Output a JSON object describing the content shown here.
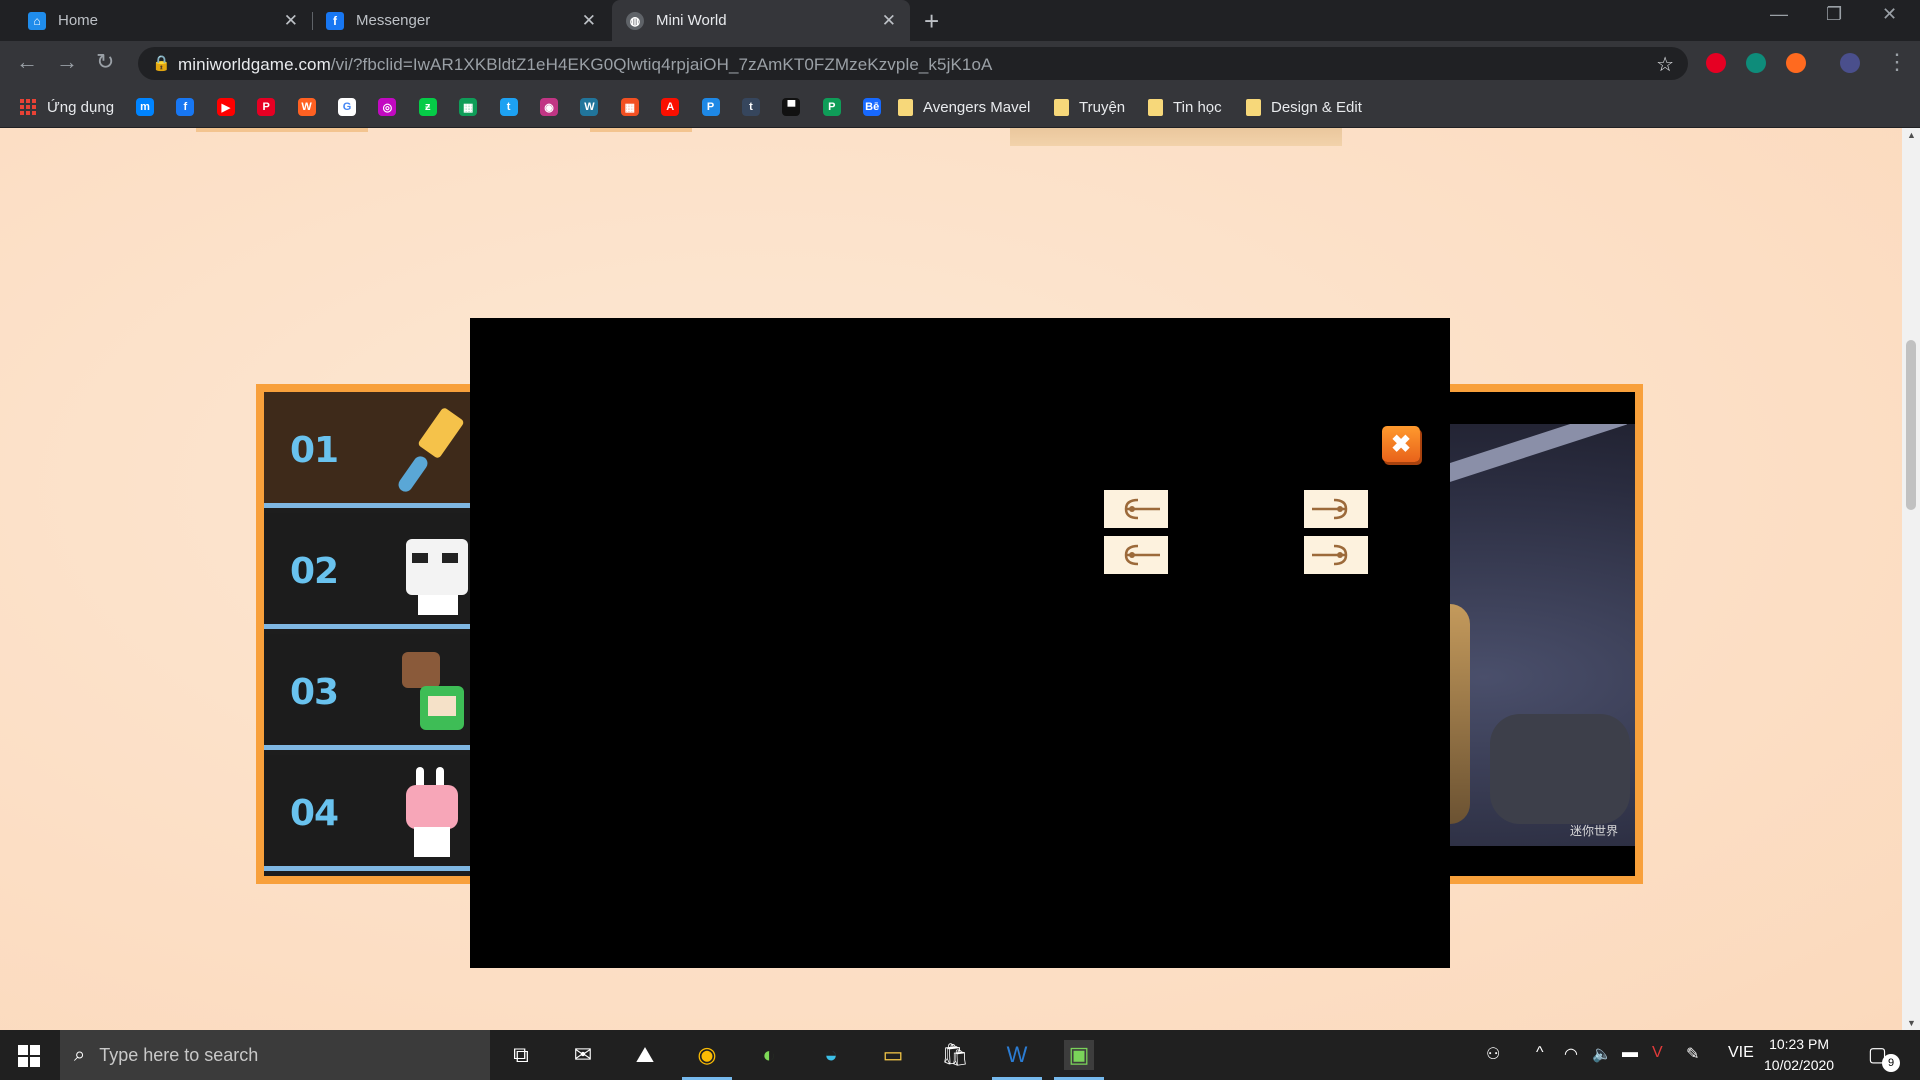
{
  "browser": {
    "tabs": [
      {
        "title": "Home",
        "icon": "home-icon",
        "color": "#1f8ceb"
      },
      {
        "title": "Messenger",
        "icon": "facebook-icon",
        "color": "#1877f2"
      },
      {
        "title": "Mini World",
        "icon": "globe-icon",
        "color": "#9aa0a6"
      }
    ],
    "url_host": "miniworldgame.com",
    "url_path": "/vi/?fbclid=IwAR1XKBldtZ1eH4EKG0Qlwtiq4rpjaiOH_7zAmKT0FZMzeKzvple_k5jK1oA",
    "bookmarks": {
      "apps_label": "Ứng dụng",
      "folders": [
        "Avengers Mavel",
        "Truyện",
        "Tin học",
        "Design & Edit"
      ],
      "site_icons": [
        {
          "name": "messenger-icon",
          "color": "#0084ff",
          "glyph": "m"
        },
        {
          "name": "facebook-icon",
          "color": "#1877f2",
          "glyph": "f"
        },
        {
          "name": "youtube-icon",
          "color": "#ff0000",
          "glyph": "▶"
        },
        {
          "name": "pinterest-icon",
          "color": "#e60023",
          "glyph": "P"
        },
        {
          "name": "wattpad-icon",
          "color": "#ff6122",
          "glyph": "W"
        },
        {
          "name": "google-icon",
          "color": "#ffffff",
          "glyph": "G"
        },
        {
          "name": "picsart-icon",
          "color": "#c209c1",
          "glyph": "◎"
        },
        {
          "name": "deviantart-icon",
          "color": "#05cc47",
          "glyph": "ƶ"
        },
        {
          "name": "sheets-icon",
          "color": "#0f9d58",
          "glyph": "▦"
        },
        {
          "name": "twitter-icon",
          "color": "#1da1f2",
          "glyph": "t"
        },
        {
          "name": "instagram-icon",
          "color": "#c13584",
          "glyph": "◉"
        },
        {
          "name": "wordpress-icon",
          "color": "#21759b",
          "glyph": "W"
        },
        {
          "name": "microsoft-icon",
          "color": "#f25022",
          "glyph": "▦"
        },
        {
          "name": "adobe-icon",
          "color": "#fa0f00",
          "glyph": "A"
        },
        {
          "name": "picsart-p-icon",
          "color": "#1e88e5",
          "glyph": "P"
        },
        {
          "name": "tumblr-icon",
          "color": "#36465d",
          "glyph": "t"
        },
        {
          "name": "unsplash-icon",
          "color": "#111111",
          "glyph": "▀"
        },
        {
          "name": "pixiv-icon",
          "color": "#0f9d58",
          "glyph": "P"
        },
        {
          "name": "behance-icon",
          "color": "#1769ff",
          "glyph": "Bē"
        }
      ]
    }
  },
  "page": {
    "menu_items": [
      "01",
      "02",
      "03",
      "04"
    ],
    "scene_watermark": "迷你世界"
  },
  "modal": {
    "close_label": "✖"
  },
  "taskbar": {
    "search_placeholder": "Type here to search",
    "language": "VIE",
    "time": "10:23 PM",
    "date": "10/02/2020",
    "notification_count": "9"
  }
}
